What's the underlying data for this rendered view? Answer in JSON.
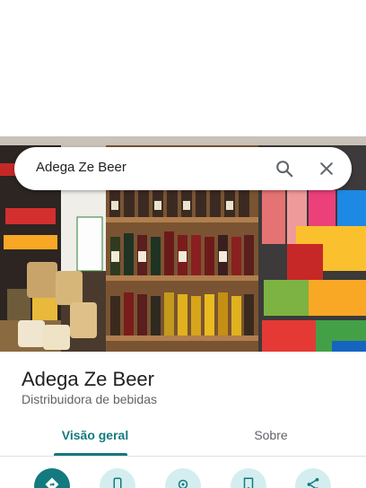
{
  "search": {
    "query": "Adega Ze Beer",
    "search_icon": "search-icon",
    "close_icon": "close-icon"
  },
  "photo": {
    "subject": "store-shelves-photo"
  },
  "place": {
    "name": "Adega Ze Beer",
    "category": "Distribuidora de bebidas"
  },
  "tabs": [
    {
      "label": "Visão geral",
      "active": true
    },
    {
      "label": "Sobre",
      "active": false
    }
  ],
  "actions": [
    {
      "icon": "directions-icon"
    },
    {
      "icon": "phone-icon"
    },
    {
      "icon": "location-icon"
    },
    {
      "icon": "save-icon"
    },
    {
      "icon": "share-icon"
    }
  ],
  "colors": {
    "accent": "#137a7f",
    "accent_light": "#d4eef0",
    "text_primary": "#202124",
    "text_secondary": "#5f6368"
  }
}
